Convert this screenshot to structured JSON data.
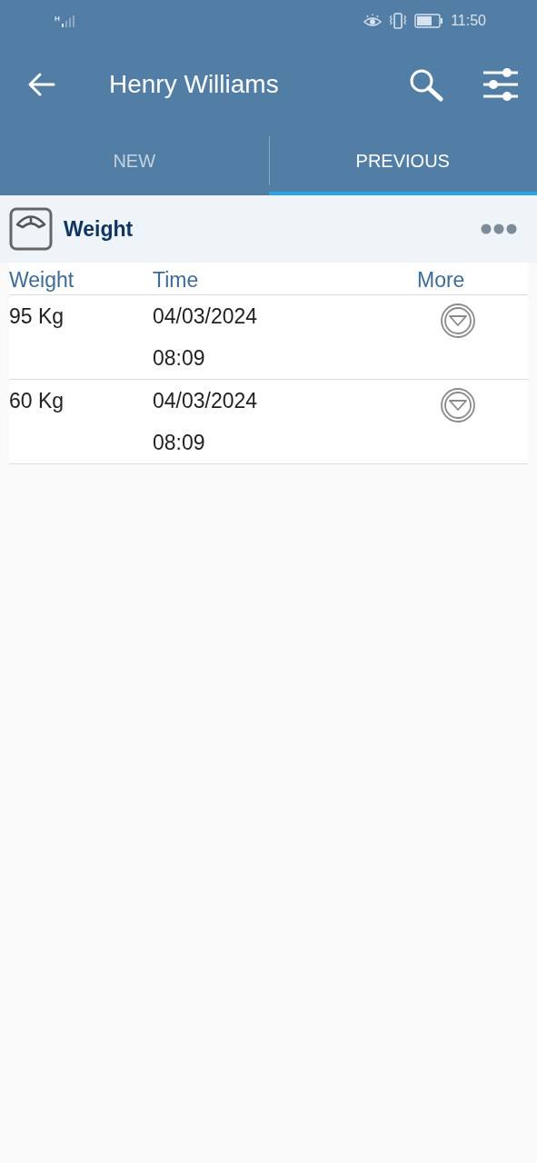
{
  "status_bar": {
    "network": "H",
    "time": "11:50"
  },
  "header": {
    "title": "Henry Williams"
  },
  "tabs": [
    {
      "label": "NEW",
      "selected": false
    },
    {
      "label": "PREVIOUS",
      "selected": true
    }
  ],
  "card": {
    "title": "Weight",
    "table": {
      "columns": [
        "Weight",
        "Time",
        "More"
      ],
      "rows": [
        {
          "weight": "95 Kg",
          "date": "04/03/2024",
          "time": "08:09"
        },
        {
          "weight": "60 Kg",
          "date": "04/03/2024",
          "time": "08:09"
        }
      ]
    }
  }
}
